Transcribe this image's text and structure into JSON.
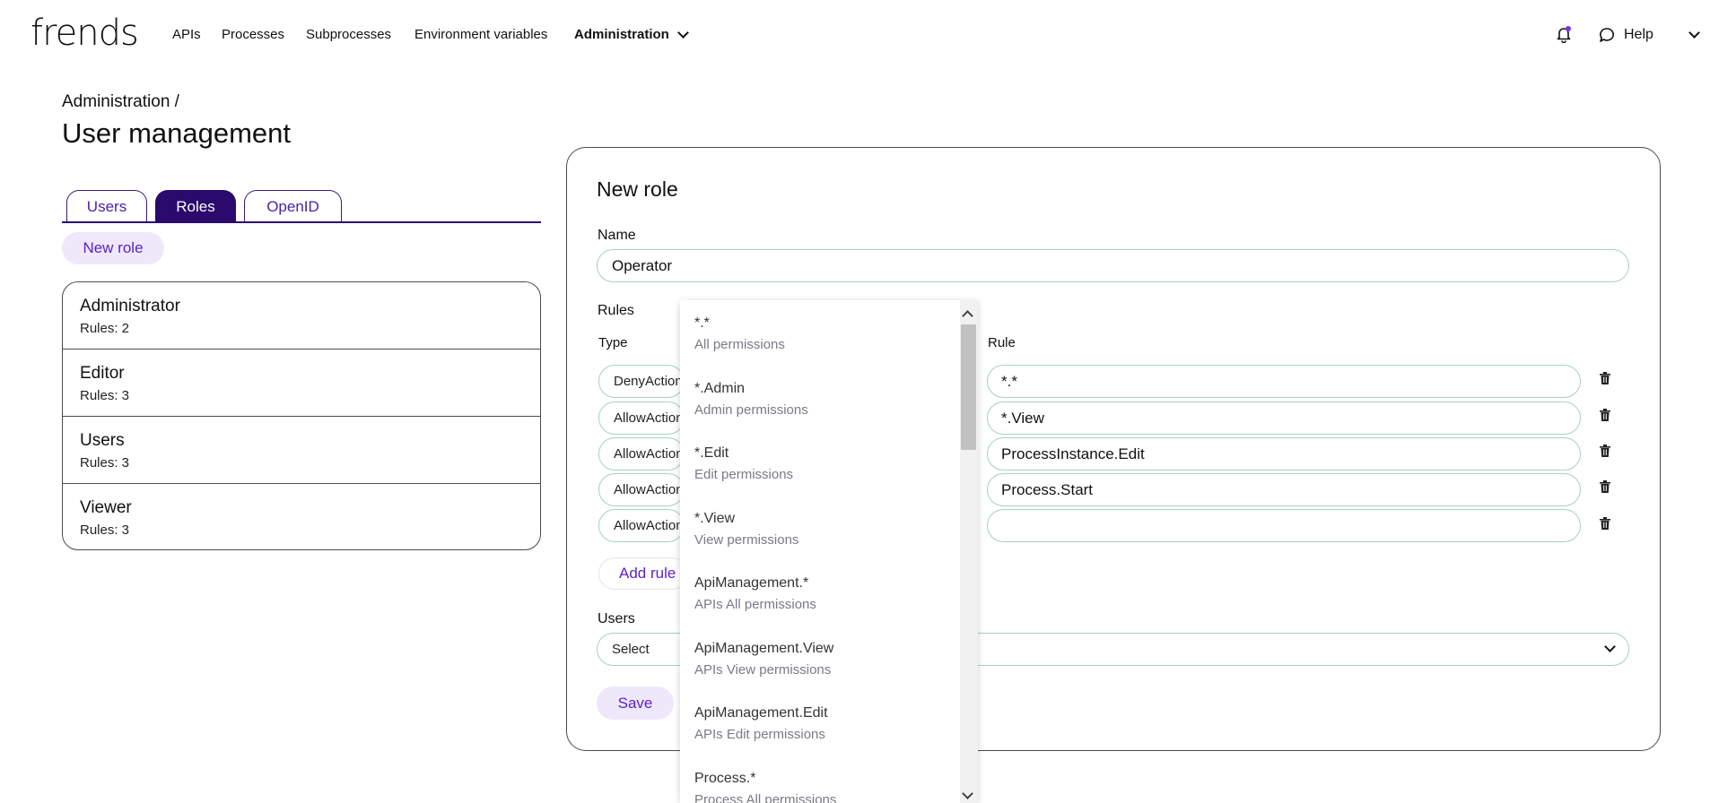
{
  "nav": {
    "logo": "frends",
    "items": [
      "APIs",
      "Processes",
      "Subprocesses",
      "Environment variables"
    ],
    "admin": "Administration",
    "help": "Help"
  },
  "page": {
    "breadcrumb": "Administration /",
    "title": "User management"
  },
  "tabs": [
    "Users",
    "Roles",
    "OpenID"
  ],
  "active_tab": "Roles",
  "new_role_button": "New role",
  "roles": [
    {
      "name": "Administrator",
      "rules": "Rules: 2"
    },
    {
      "name": "Editor",
      "rules": "Rules: 3"
    },
    {
      "name": "Users",
      "rules": "Rules: 3"
    },
    {
      "name": "Viewer",
      "rules": "Rules: 3"
    }
  ],
  "form": {
    "title": "New role",
    "name_label": "Name",
    "name_value": "Operator",
    "rules_label": "Rules",
    "type_header": "Type",
    "rule_header": "Rule",
    "rules": [
      {
        "type": "DenyAction",
        "rule": "*.*"
      },
      {
        "type": "AllowAction",
        "rule": "*.View"
      },
      {
        "type": "AllowAction",
        "rule": "ProcessInstance.Edit"
      },
      {
        "type": "AllowAction",
        "rule": "Process.Start"
      },
      {
        "type": "AllowAction",
        "rule": ""
      }
    ],
    "add_rule": "Add rule",
    "users_label": "Users",
    "users_placeholder": "Select",
    "save": "Save"
  },
  "dropdown": {
    "options": [
      {
        "key": "*.*",
        "desc": "All permissions"
      },
      {
        "key": "*.Admin",
        "desc": "Admin permissions"
      },
      {
        "key": "*.Edit",
        "desc": "Edit permissions"
      },
      {
        "key": "*.View",
        "desc": "View permissions"
      },
      {
        "key": "ApiManagement.*",
        "desc": "APIs All permissions"
      },
      {
        "key": "ApiManagement.View",
        "desc": "APIs View permissions"
      },
      {
        "key": "ApiManagement.Edit",
        "desc": "APIs Edit permissions"
      },
      {
        "key": "Process.*",
        "desc": "Process All permissions"
      }
    ]
  },
  "colors": {
    "brand_purple": "#2b0a6e",
    "accent_purple": "#5a22c8",
    "input_border": "#a8cfc6"
  }
}
